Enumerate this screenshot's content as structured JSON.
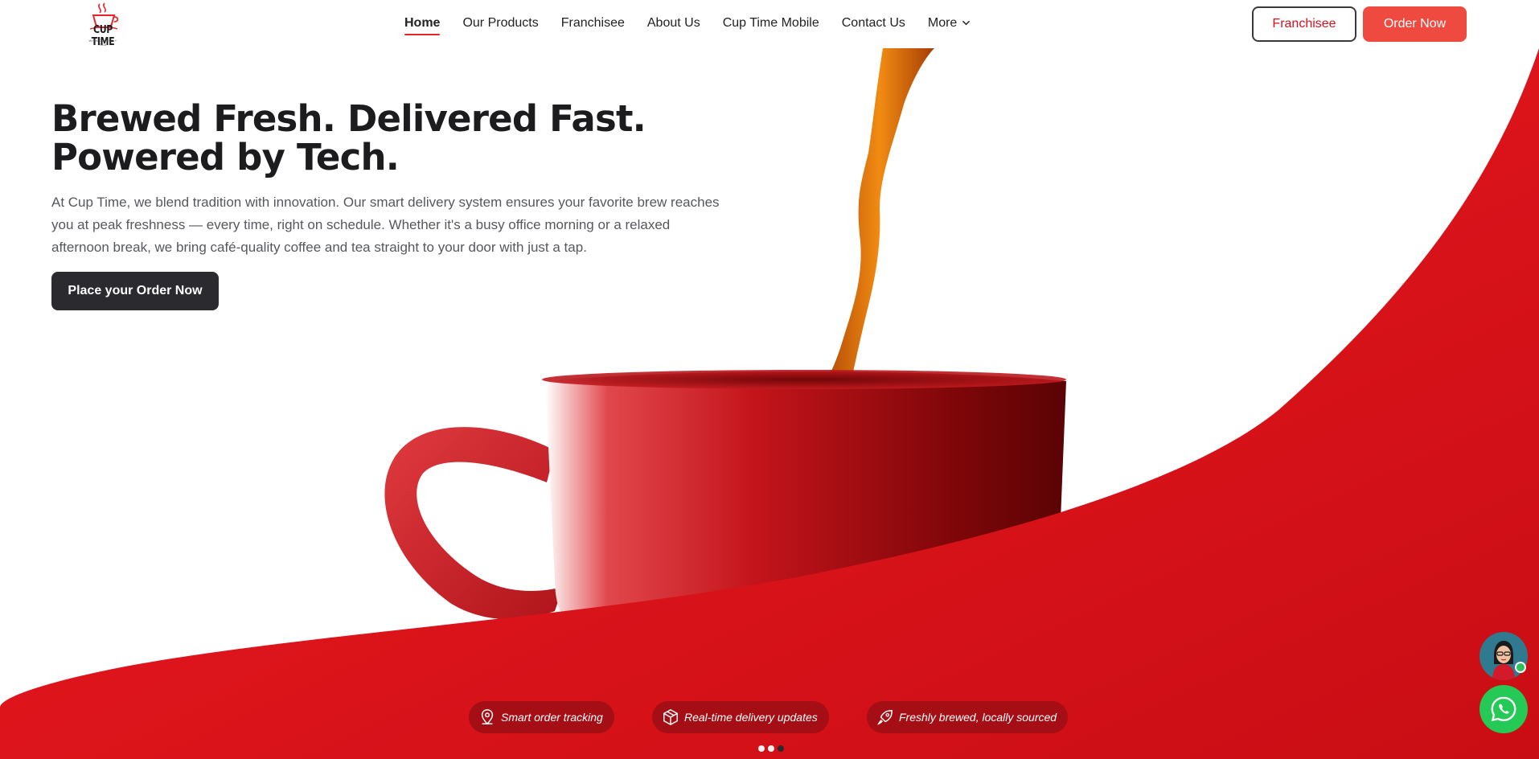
{
  "brand": {
    "logo_text": "CUP TIME",
    "logo_tagline": "WITH COFFEE + TEA",
    "accent_color": "#e8232b",
    "cta_color": "#ef4a3f"
  },
  "nav": {
    "items": [
      {
        "label": "Home",
        "active": true
      },
      {
        "label": "Our Products"
      },
      {
        "label": "Franchisee"
      },
      {
        "label": "About Us"
      },
      {
        "label": "Cup Time Mobile"
      },
      {
        "label": "Contact Us"
      },
      {
        "label": "More"
      }
    ],
    "franchisee_button": "Franchisee",
    "order_button": "Order Now"
  },
  "hero": {
    "title_line1": "Brewed Fresh. Delivered Fast.",
    "title_line2": "Powered by Tech.",
    "description": "At Cup Time, we blend tradition with innovation. Our smart delivery system ensures your favorite brew reaches you at peak freshness — every time, right on schedule. Whether it's a busy office morning or a relaxed afternoon break, we bring café-quality coffee and tea straight to your door with just a tap.",
    "cta": "Place your Order Now"
  },
  "features": [
    {
      "label": "Smart order tracking",
      "icon": "location-pin-icon"
    },
    {
      "label": "Real-time delivery updates",
      "icon": "package-icon"
    },
    {
      "label": "Freshly brewed, locally sourced",
      "icon": "rocket-icon"
    }
  ],
  "carousel": {
    "active_index": 2,
    "count": 3
  }
}
